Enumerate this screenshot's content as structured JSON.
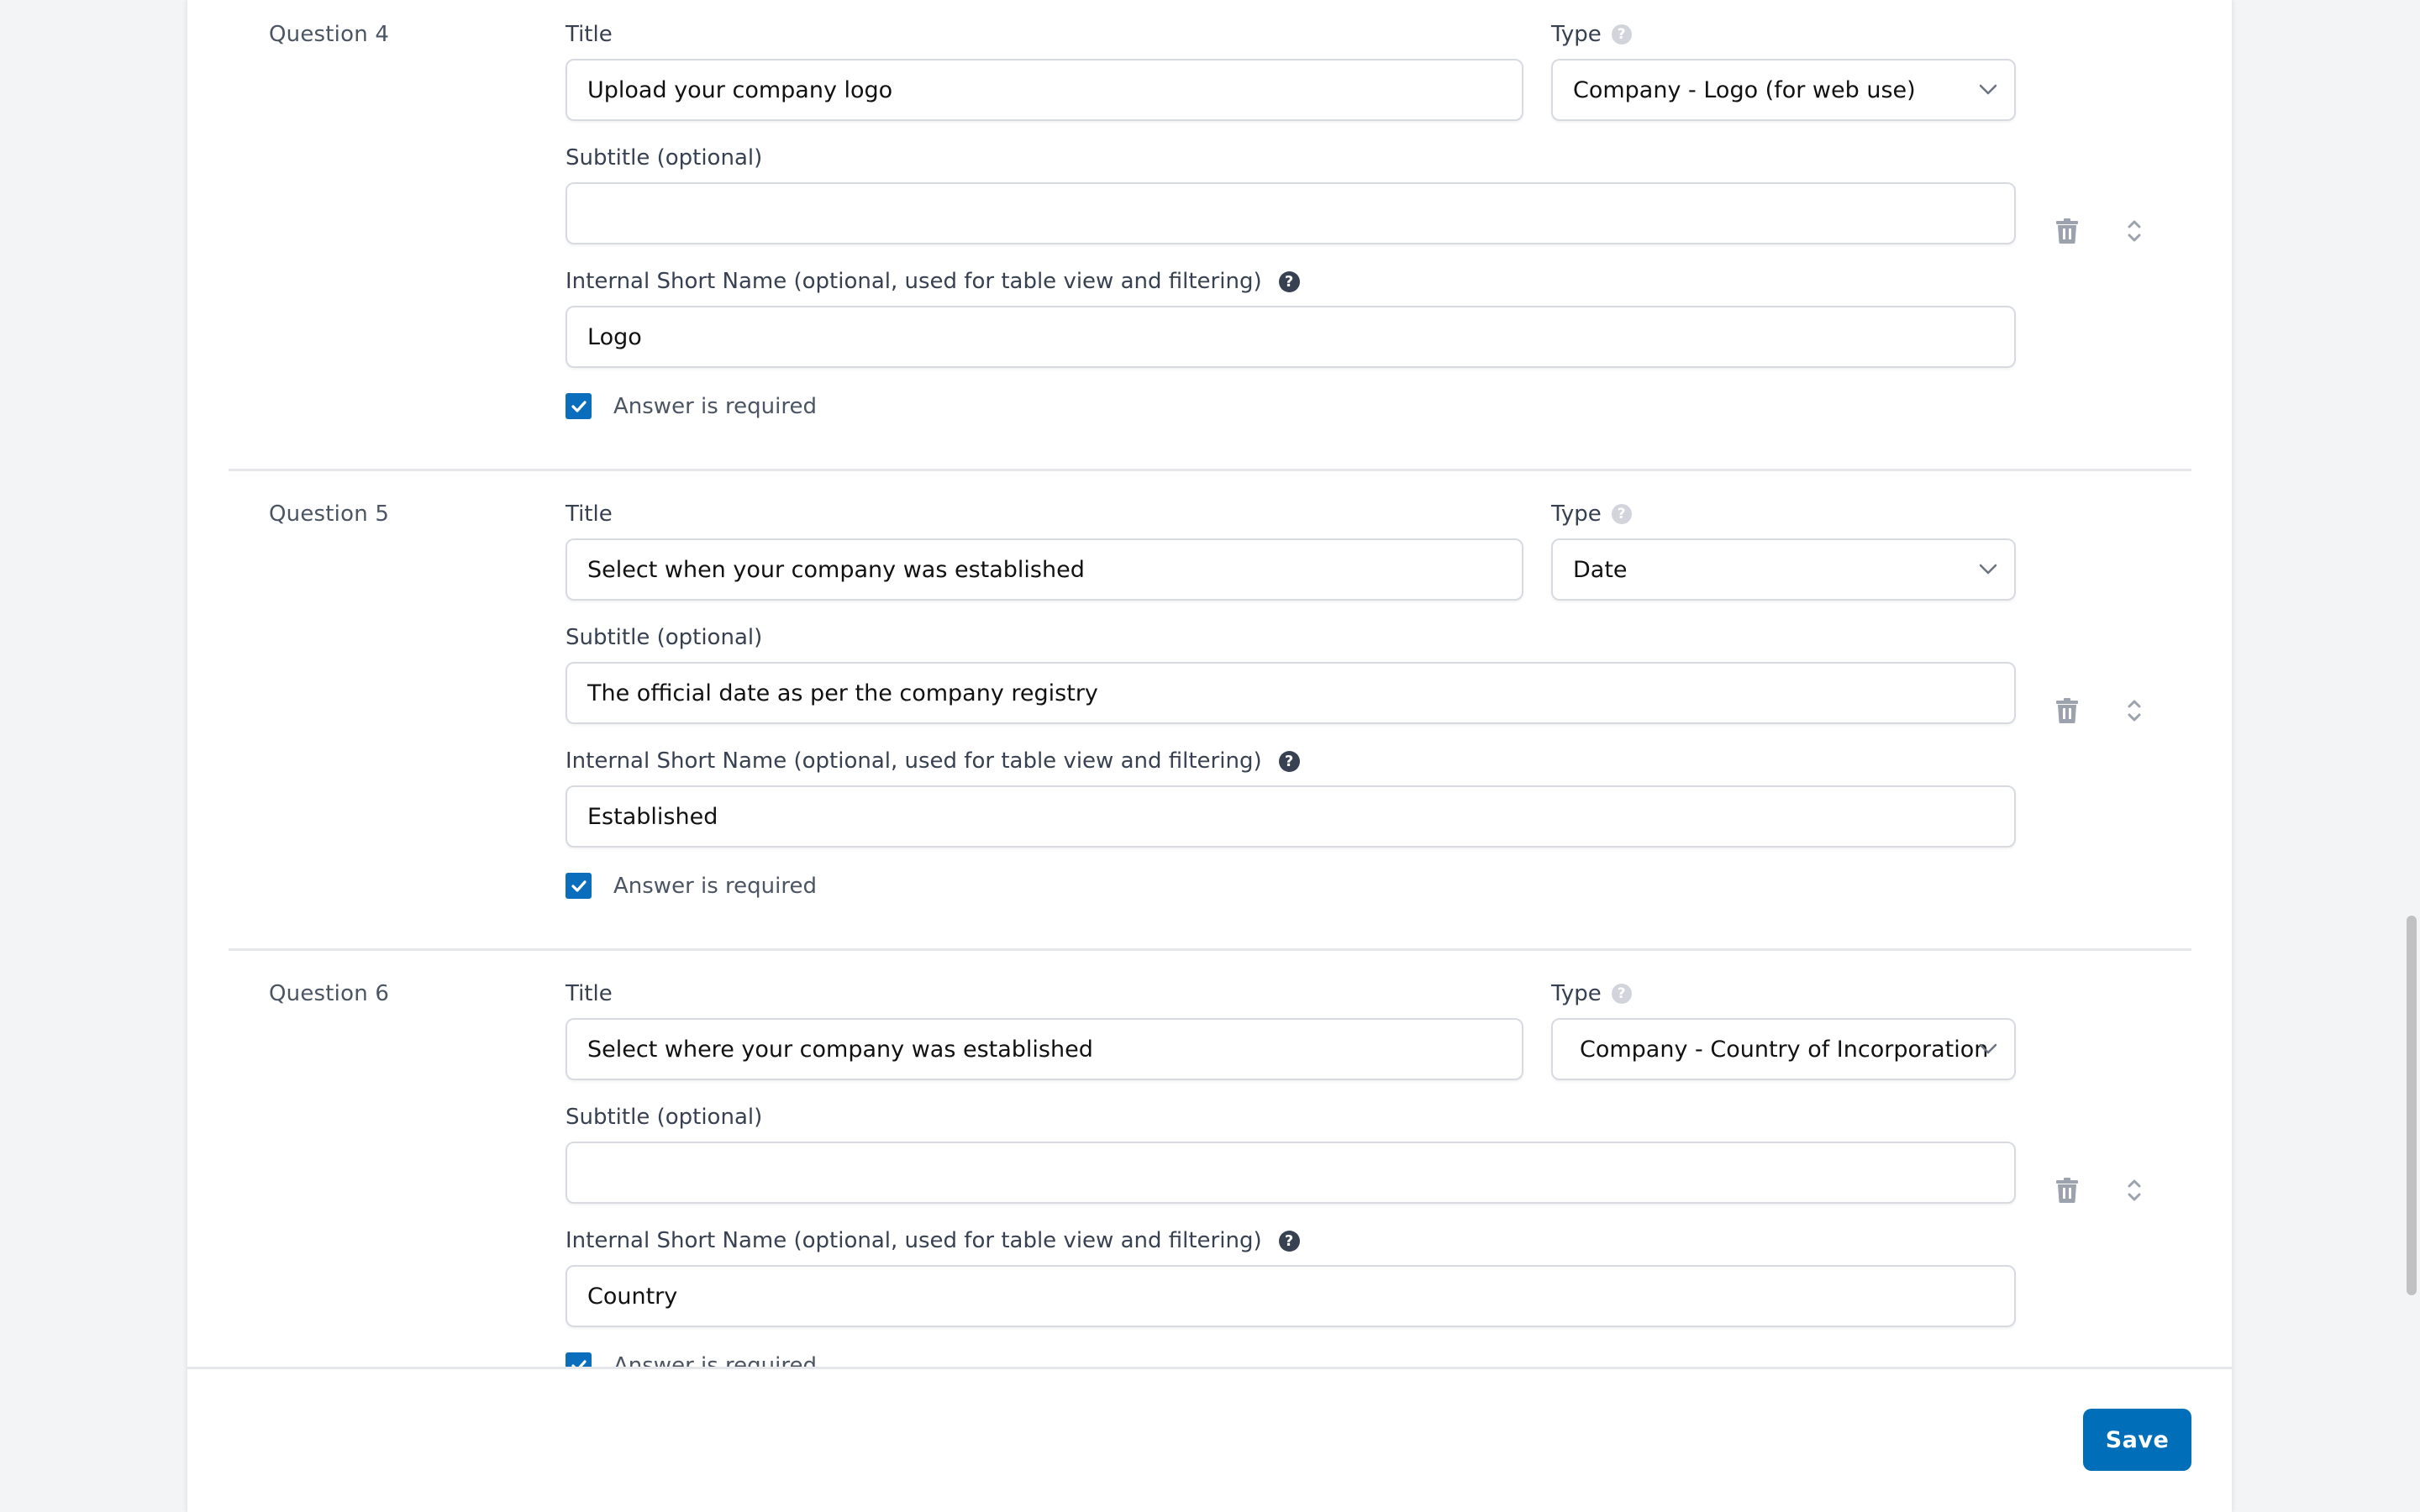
{
  "labels": {
    "title": "Title",
    "type": "Type",
    "subtitle": "Subtitle (optional)",
    "short_name": "Internal Short Name (optional, used for table view and filtering)",
    "required": "Answer is required",
    "help_glyph": "?"
  },
  "questions": [
    {
      "label": "Question 4",
      "title_value": "Upload your company logo",
      "type_value": "Company - Logo (for web use)",
      "subtitle_value": "",
      "short_name_value": "Logo",
      "required": true
    },
    {
      "label": "Question 5",
      "title_value": "Select when your company was established",
      "type_value": "Date",
      "subtitle_value": "The official date as per the company registry",
      "short_name_value": "Established",
      "required": true
    },
    {
      "label": "Question 6",
      "title_value": "Select where your company was established",
      "type_value": "Company - Country of Incorporation",
      "subtitle_value": "",
      "short_name_value": "Country",
      "required": true
    }
  ],
  "icons": {
    "delete": "trash-icon",
    "reorder": "reorder-chevrons-icon",
    "dropdown": "chevron-down-icon",
    "help": "question-circle-icon",
    "check": "checkmark-icon"
  },
  "footer": {
    "save_label": "Save"
  },
  "colors": {
    "primary": "#006EB8",
    "checkbox": "#0A6EBD",
    "background": "#F3F4F6",
    "icon_gray": "#9CA3AF"
  }
}
